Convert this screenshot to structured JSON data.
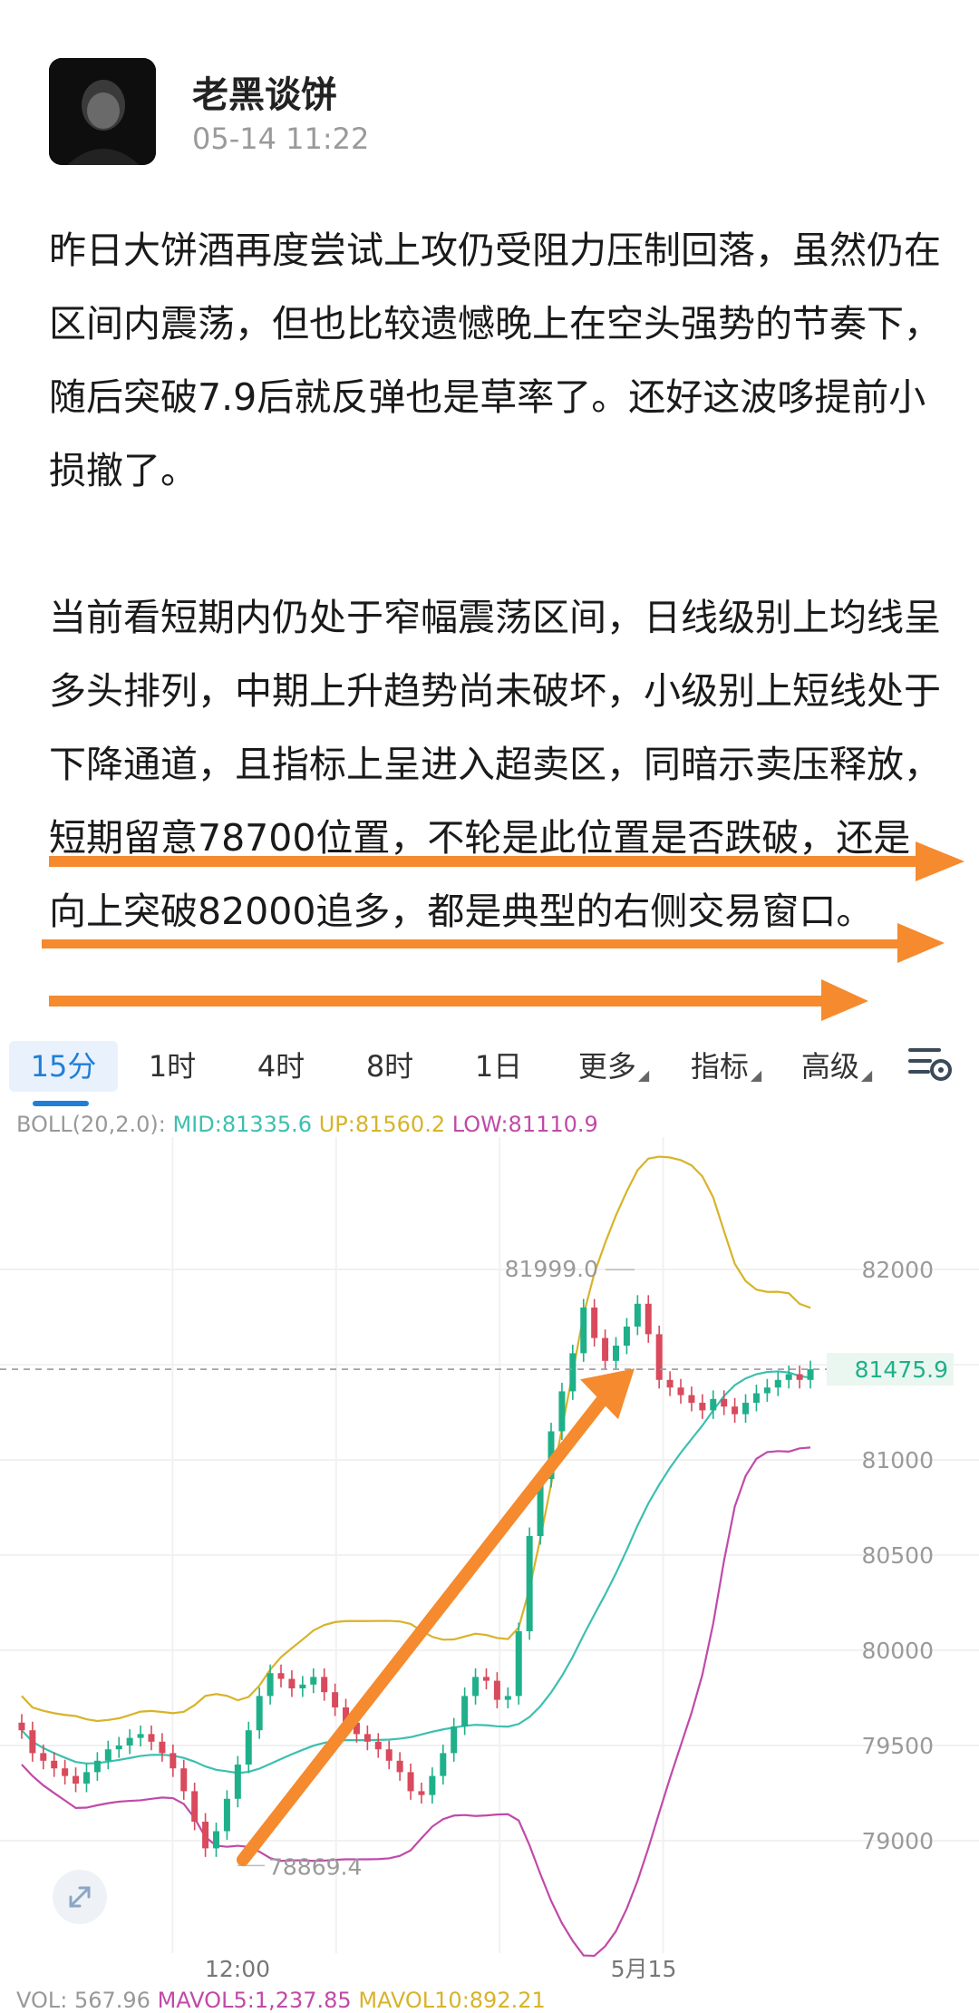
{
  "author": {
    "name": "老黑谈饼",
    "time": "05-14 11:22"
  },
  "post": {
    "paragraph1": "昨日大饼酒再度尝试上攻仍受阻力压制回落，虽然仍在区间内震荡，但也比较遗憾晚上在空头强势的节奏下，随后突破7.9后就反弹也是草率了。还好这波哆提前小损撤了。",
    "paragraph2": "当前看短期内仍处于窄幅震荡区间，日线级别上均线呈多头排列，中期上升趋势尚未破坏，小级别上短线处于下降通道，且指标上呈进入超卖区，同暗示卖压释放，短期留意78700位置，不轮是此位置是否跌破，还是向上突破82000追多，都是典型的右侧交易窗口。"
  },
  "tabs": {
    "t15m": "15分",
    "t1h": "1时",
    "t4h": "4时",
    "t8h": "8时",
    "t1d": "1日",
    "more": "更多",
    "indicator": "指标",
    "advanced": "高级"
  },
  "indicator": {
    "label": "BOLL(20,2.0):",
    "mid": "MID:81335.6",
    "up": "UP:81560.2",
    "low": "LOW:81110.9"
  },
  "volume": {
    "vol": "VOL: 567.96",
    "mavol5": "MAVOL5:1,237.85",
    "mavol10": "MAVOL10:892.21"
  },
  "colors": {
    "accent": "#1f7fd8",
    "up": "#1fb08a",
    "down": "#d84a5c",
    "arrow": "#f58a2e",
    "boll_mid": "#3cbfb0",
    "boll_up": "#d8b32a",
    "boll_low": "#c04aa8"
  },
  "chart_data": {
    "type": "candlestick",
    "ylim": [
      78600,
      82600
    ],
    "y_ticks": [
      "82000",
      "81500",
      "81000",
      "80500",
      "80000",
      "79500",
      "79000"
    ],
    "y_tick_values": [
      82000,
      81500,
      81000,
      80500,
      80000,
      79500,
      79000
    ],
    "x_ticks": [
      "12:00",
      "5月15"
    ],
    "current_price_label": "81475.9",
    "current_price": 81475.9,
    "high_label": "81999.0",
    "high": 81999.0,
    "low_label": "78869.4",
    "low": 78869.4,
    "closes": [
      79580,
      79460,
      79420,
      79380,
      79340,
      79300,
      79360,
      79420,
      79480,
      79500,
      79540,
      79560,
      79520,
      79460,
      79380,
      79260,
      79100,
      78960,
      79050,
      79220,
      79400,
      79580,
      79760,
      79880,
      79850,
      79800,
      79820,
      79860,
      79780,
      79700,
      79620,
      79560,
      79520,
      79480,
      79420,
      79360,
      79260,
      79240,
      79340,
      79460,
      79600,
      79760,
      79860,
      79840,
      79740,
      79760,
      80100,
      80600,
      80900,
      81150,
      81360,
      81560,
      81800,
      81640,
      81520,
      81600,
      81700,
      81820,
      81660,
      81420,
      81380,
      81340,
      81300,
      81260,
      81320,
      81280,
      81240,
      81300,
      81350,
      81380,
      81420,
      81450,
      81420,
      81476
    ]
  }
}
